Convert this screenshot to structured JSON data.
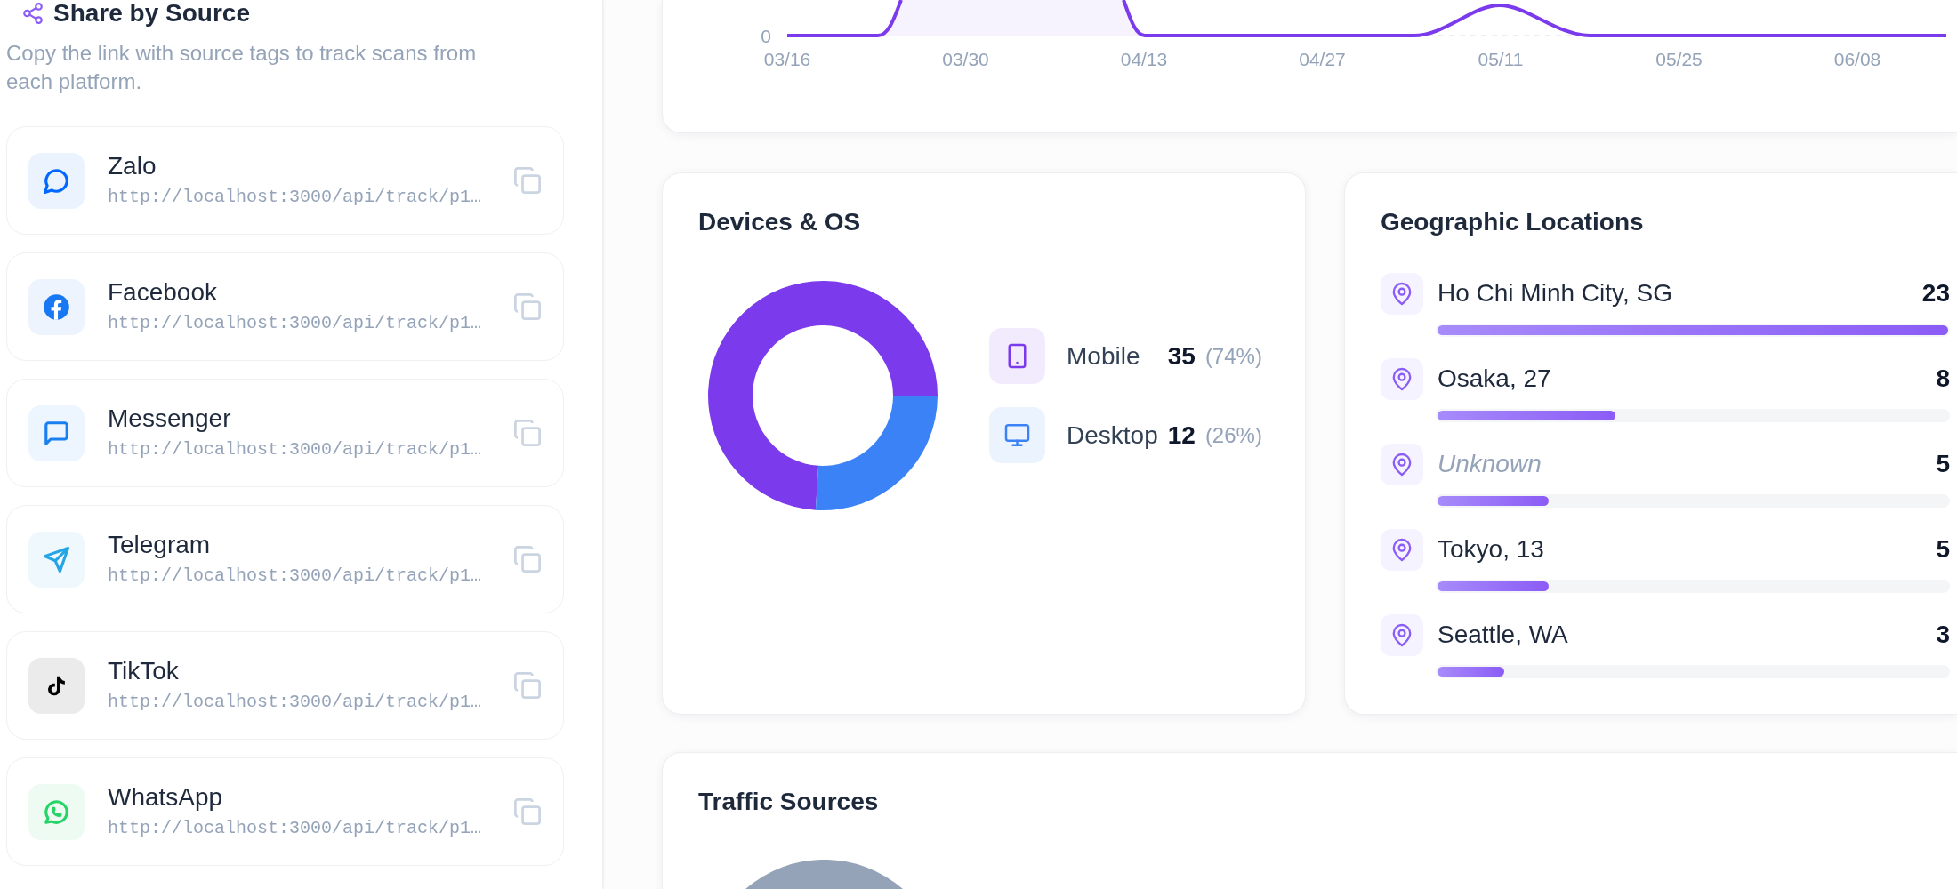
{
  "share_panel": {
    "title": "Share by Source",
    "description": "Copy the link with source tags to track scans from each platform.",
    "sources": [
      {
        "name": "Zalo",
        "url": "http://localhost:3000/api/track/p1…",
        "kind": "chat-round",
        "color": "#0068ff"
      },
      {
        "name": "Facebook",
        "url": "http://localhost:3000/api/track/p1…",
        "kind": "letter-f",
        "color": "#1877f2"
      },
      {
        "name": "Messenger",
        "url": "http://localhost:3000/api/track/p1…",
        "kind": "chat-square",
        "color": "#1a7ff0"
      },
      {
        "name": "Telegram",
        "url": "http://localhost:3000/api/track/p1…",
        "kind": "plane",
        "color": "#26a5e4"
      },
      {
        "name": "TikTok",
        "url": "http://localhost:3000/api/track/p1…",
        "kind": "note",
        "color": "#000000"
      },
      {
        "name": "WhatsApp",
        "url": "http://localhost:3000/api/track/p1…",
        "kind": "phone-chat",
        "color": "#25d366"
      }
    ]
  },
  "trend_chart": {
    "y_tick": "0",
    "x_ticks": [
      "03/16",
      "03/30",
      "04/13",
      "04/27",
      "05/11",
      "05/25",
      "06/08"
    ]
  },
  "devices": {
    "title": "Devices & OS",
    "chart_data": {
      "type": "donut",
      "categories": [
        "Mobile",
        "Desktop"
      ],
      "values": [
        74,
        26
      ]
    },
    "legend": [
      {
        "kind": "phone",
        "count": "35",
        "share": "(74%)",
        "color": "#7c3aed"
      },
      {
        "kind": "monitor",
        "count": "12",
        "share": "(26%)",
        "color": "#3b82f6"
      }
    ]
  },
  "locations": {
    "title": "Geographic Locations",
    "items": [
      {
        "name": "Ho Chi Minh City, SG",
        "count": "23",
        "level": 1,
        "muted": false
      },
      {
        "name": "Osaka, 27",
        "count": "8",
        "level": 0.348,
        "muted": false
      },
      {
        "name": "Unknown",
        "count": "5",
        "level": 0.217,
        "muted": true
      },
      {
        "name": "Tokyo, 13",
        "count": "5",
        "level": 0.217,
        "muted": false
      },
      {
        "name": "Seattle, WA",
        "count": "3",
        "level": 0.13,
        "muted": false
      }
    ]
  },
  "traffic_sources": {
    "title": "Traffic Sources"
  }
}
